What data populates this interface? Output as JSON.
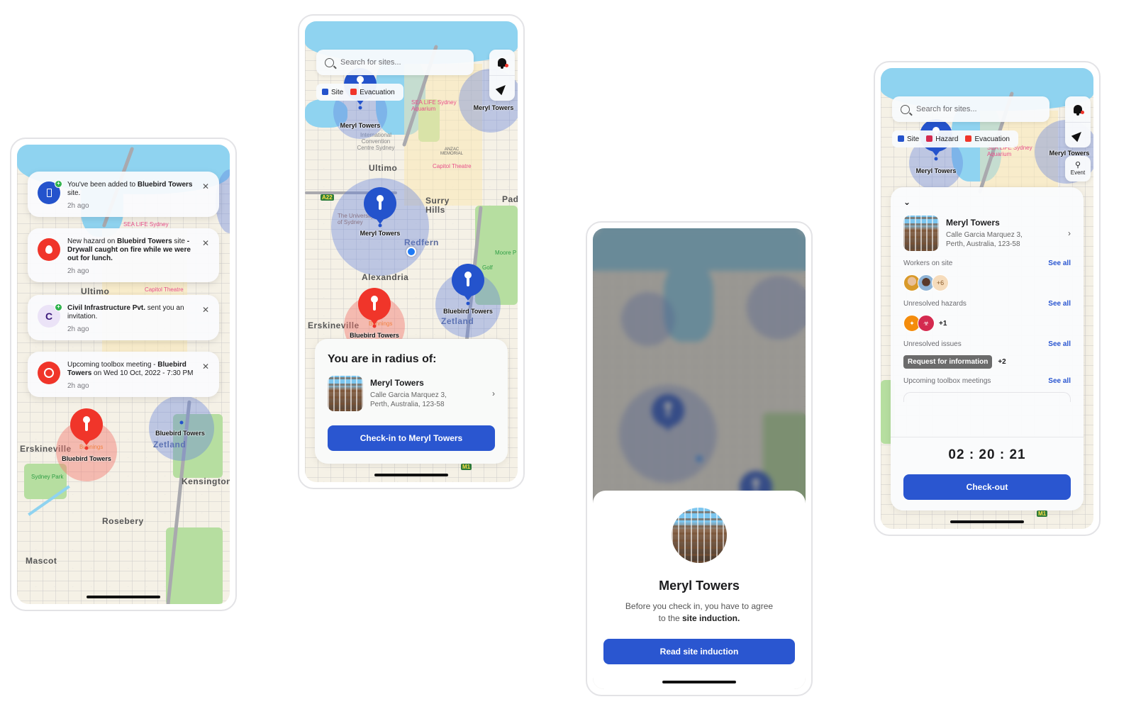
{
  "colors": {
    "primary": "#2a56d0",
    "site": "#2453cc",
    "hazard": "#d42a4f",
    "evacuation": "#f0352a",
    "success": "#2fb24c"
  },
  "map": {
    "search_placeholder": "Search for sites...",
    "legend": {
      "site": "Site",
      "hazard": "Hazard",
      "evacuation": "Evacuation"
    },
    "controls": {
      "notifications_icon": "bell-icon",
      "locate_icon": "navigation-arrow-icon",
      "event_label": "Event"
    },
    "places": {
      "ultimo": "Ultimo",
      "surry_hills": "Surry Hills",
      "redfern": "Redfern",
      "alexandria": "Alexandria",
      "erskineville": "Erskineville",
      "zetland": "Zetland",
      "kensington": "Kensington",
      "rosebery": "Rosebery",
      "mascot": "Mascot",
      "paddington_partial": "Pad",
      "sea_life": "SEA LIFE Sydney Aquarium",
      "sea_life_short": "SEA LIFE Sydney",
      "capitol_theatre": "Capitol Theatre",
      "anzac": "ANZAC MEMORIAL",
      "icc": "International Convention Centre Sydney",
      "university": "The University of Sydney",
      "sydney_park": "Sydney Park",
      "moore_park": "Moore P",
      "bunnings": "Bunnings",
      "golf": "Golf",
      "a22": "A22",
      "m1": "M1"
    },
    "sites": {
      "meryl": "Meryl Towers",
      "bluebird": "Bluebird Towers"
    }
  },
  "notifications": [
    {
      "icon": "site-icon",
      "icon_color": "#2453cc",
      "badge": "+",
      "text_pre": "You've been added to ",
      "text_bold": "Bluebird Towers",
      "text_post": " site.",
      "time": "2h ago"
    },
    {
      "icon": "fire-icon",
      "icon_color": "#f0352a",
      "text_pre": "New hazard on ",
      "text_bold": "Bluebird Towers",
      "text_mid": " site ",
      "text_bold2": "- Drywall caught on fire while we were out for lunch.",
      "time": "2h ago"
    },
    {
      "icon": "company-initial-icon",
      "icon_color": "#ebe3f7",
      "initial": "C",
      "badge": "+",
      "text_bold": "Civil Infrastructure Pvt.",
      "text_post": " sent you an invitation.",
      "time": "2h ago"
    },
    {
      "icon": "toolbox-meeting-icon",
      "icon_color": "#f0352a",
      "text_pre": "Upcoming toolbox meeting - ",
      "text_bold": "Bluebird Towers",
      "text_post": " on Wed 10 Oct, 2022 - 7:30 PM",
      "time": "2h ago"
    }
  ],
  "radius_card": {
    "title": "You are in radius of:",
    "site_name": "Meryl Towers",
    "address_line1": "Calle Garcia Marquez 3,",
    "address_line2": "Perth, Australia, 123-58",
    "button": "Check-in to Meryl Towers"
  },
  "induction": {
    "site_name": "Meryl Towers",
    "text_pre": "Before you check in, you have to agree to the ",
    "text_bold": "site induction.",
    "button": "Read site induction"
  },
  "checked_in": {
    "site_name": "Meryl Towers",
    "address_line1": "Calle Garcia Marquez 3,",
    "address_line2": "Perth, Australia, 123-58",
    "workers_label": "Workers on site",
    "workers_more": "+6",
    "hazards_label": "Unresolved hazards",
    "hazards_more": "+1",
    "issues_label": "Unresolved issues",
    "issue_tag": "Request for information",
    "issues_more": "+2",
    "meetings_label": "Upcoming toolbox meetings",
    "see_all": "See all",
    "timer": "02 : 20 : 21",
    "button": "Check-out"
  }
}
